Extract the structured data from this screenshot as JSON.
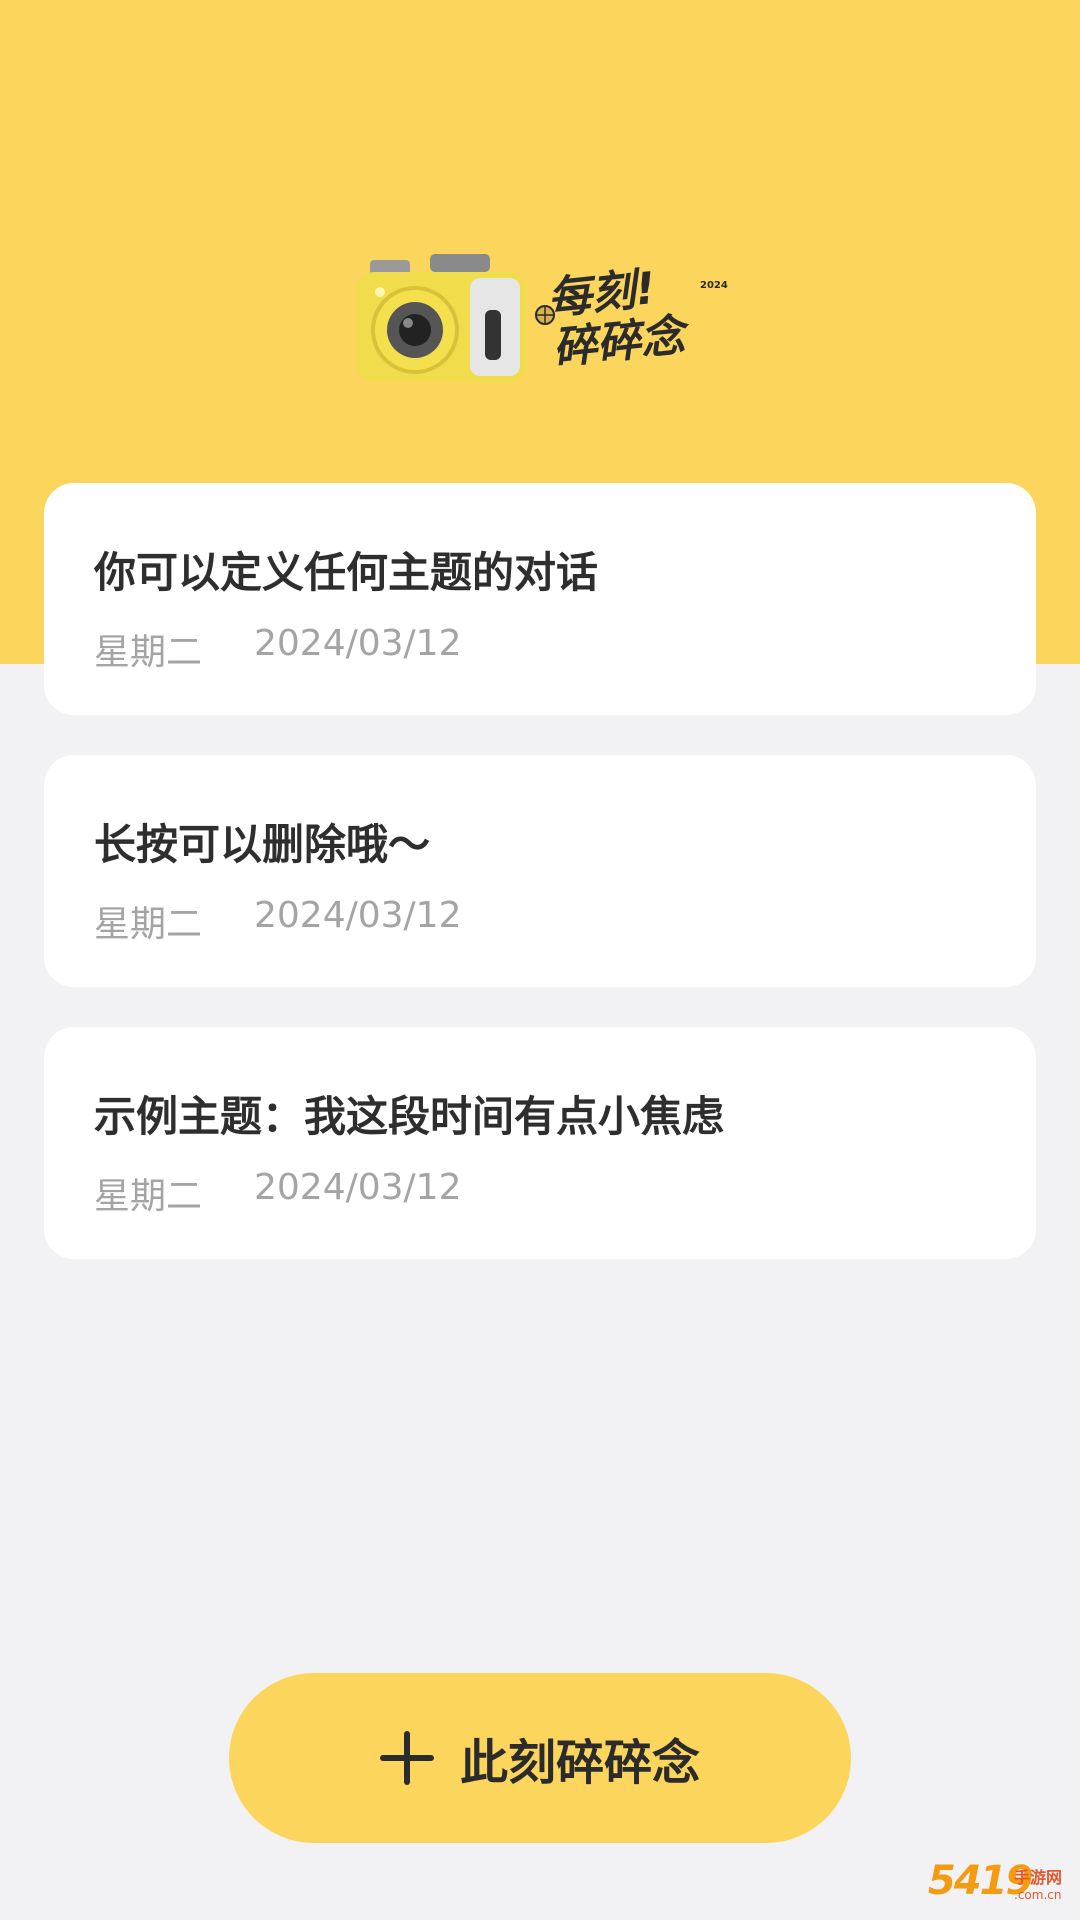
{
  "app": {
    "logo": {
      "line1": "每刻!",
      "line2": "碎碎念",
      "year": "2024"
    }
  },
  "entries": [
    {
      "title": "你可以定义任何主题的对话",
      "weekday": "星期二",
      "date": "2024/03/12"
    },
    {
      "title": "长按可以删除哦～",
      "weekday": "星期二",
      "date": "2024/03/12"
    },
    {
      "title": "示例主题：我这段时间有点小焦虑",
      "weekday": "星期二",
      "date": "2024/03/12"
    }
  ],
  "add_button": {
    "label": "此刻碎碎念",
    "icon": "plus-icon"
  },
  "watermark": {
    "number": "5419",
    "text": "手游网",
    "domain": ".com.cn"
  },
  "colors": {
    "accent": "#fbd55c",
    "background": "#f2f1f3",
    "card": "#ffffff"
  }
}
